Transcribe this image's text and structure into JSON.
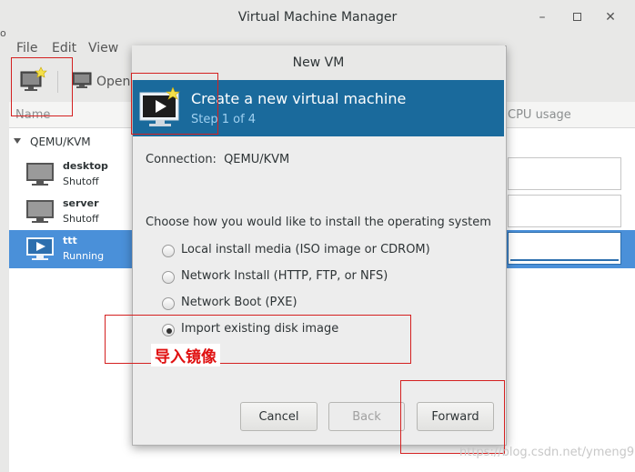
{
  "main_window": {
    "title": "Virtual Machine Manager",
    "menu": [
      "File",
      "Edit",
      "View"
    ],
    "toolbar": {
      "open_label": "Open"
    },
    "columns": {
      "name": "Name",
      "cpu": "CPU usage"
    },
    "group": "QEMU/KVM",
    "vms": [
      {
        "name": "desktop",
        "status": "Shutoff"
      },
      {
        "name": "server",
        "status": "Shutoff"
      },
      {
        "name": "ttt",
        "status": "Running"
      }
    ]
  },
  "dialog": {
    "title": "New VM",
    "banner_title": "Create a new virtual machine",
    "banner_step": "Step 1 of 4",
    "connection_label": "Connection:",
    "connection_value": "QEMU/KVM",
    "choose_label": "Choose how you would like to install the operating system",
    "options": [
      {
        "label": "Local install media (ISO image or CDROM)",
        "selected": false
      },
      {
        "label": "Network Install (HTTP, FTP, or NFS)",
        "selected": false
      },
      {
        "label": "Network Boot (PXE)",
        "selected": false
      },
      {
        "label": "Import existing disk image",
        "selected": true
      }
    ],
    "buttons": {
      "cancel": "Cancel",
      "back": "Back",
      "forward": "Forward"
    }
  },
  "annotation": {
    "text": "导入镜像"
  },
  "watermark": "https://blog.csdn.net/ymeng9527",
  "colors": {
    "banner": "#1a6a9c",
    "selection": "#4a90d9",
    "annotation": "#d42020"
  }
}
